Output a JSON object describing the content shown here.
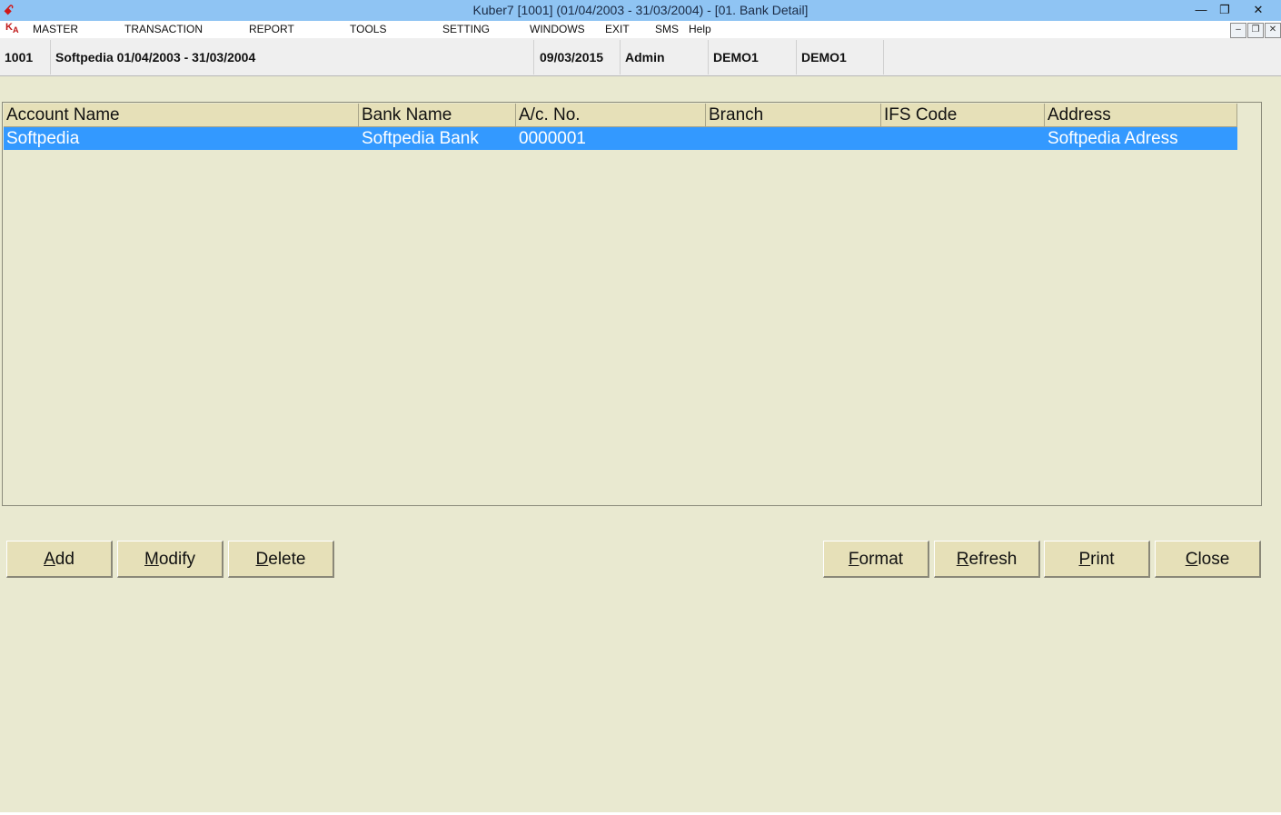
{
  "window": {
    "title": "Kuber7 [1001] (01/04/2003 - 31/03/2004) - [01. Bank Detail]",
    "app_icon": "kuber-app-icon",
    "controls": [
      "minimize-icon",
      "restore-icon",
      "close-icon"
    ]
  },
  "menu": {
    "items": [
      "MASTER",
      "TRANSACTION",
      "REPORT",
      "TOOLS",
      "SETTING",
      "WINDOWS",
      "EXIT",
      "SMS",
      "Help"
    ]
  },
  "info": {
    "code": "1001",
    "company": "Softpedia  01/04/2003 - 31/03/2004",
    "date": "09/03/2015",
    "user": "Admin",
    "db1": "DEMO1",
    "db2": "DEMO1"
  },
  "grid": {
    "columns": [
      "Account Name",
      "Bank Name",
      "A/c. No.",
      "Branch",
      "IFS Code",
      "Address"
    ],
    "rows": [
      [
        "Softpedia",
        "Softpedia Bank",
        "0000001",
        "",
        "",
        "Softpedia Adress"
      ]
    ],
    "selected_row": 0
  },
  "buttons": {
    "add": {
      "first": "A",
      "rest": "dd"
    },
    "modify": {
      "first": "M",
      "rest": "odify"
    },
    "delete": {
      "first": "D",
      "rest": "elete"
    },
    "format": {
      "first": "F",
      "rest": "ormat"
    },
    "refresh": {
      "first": "R",
      "rest": "efresh"
    },
    "print": {
      "first": "P",
      "rest": "rint"
    },
    "close": {
      "first": "C",
      "rest": "lose"
    }
  },
  "colors": {
    "background": "#e9e9d0",
    "titlebar": "#8fc4f3",
    "header": "#e6e0b8",
    "selection": "#3399ff"
  }
}
